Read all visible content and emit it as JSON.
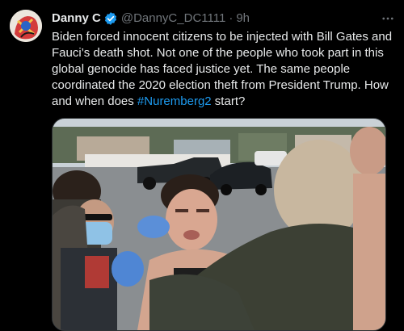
{
  "post": {
    "author_name": "Danny C",
    "handle": "@DannyC_DC1111",
    "separator": "·",
    "time": "9h",
    "text_main": "Biden forced innocent citizens to be injected with Bill Gates and Fauci’s death shot. Not one of the people who took part in this global genocide has faced justice yet. The same people coordinated the 2020 election theft from President Trump. How and when does ",
    "hashtag": "#Nuremberg2",
    "text_end": " start?"
  },
  "icons": {
    "verified": "verified-badge-icon",
    "more": "more-options-icon"
  },
  "colors": {
    "background": "#000000",
    "text": "#e7e9ea",
    "secondary_text": "#71767b",
    "link": "#1d9bf0",
    "verified": "#1d9bf0"
  }
}
